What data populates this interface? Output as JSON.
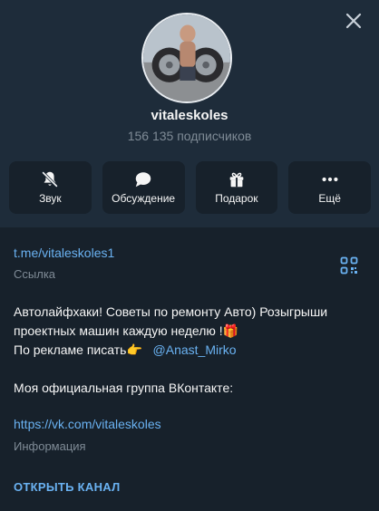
{
  "channel": {
    "name": "vitaleskoles",
    "subscribers": "156 135 подписчиков"
  },
  "actions": [
    {
      "label": "Звук",
      "icon": "bell-muted-icon"
    },
    {
      "label": "Обсуждение",
      "icon": "chat-bubble-icon"
    },
    {
      "label": "Подарок",
      "icon": "gift-icon"
    },
    {
      "label": "Ещё",
      "icon": "more-dots-icon"
    }
  ],
  "link": {
    "url": "t.me/vitaleskoles1",
    "caption": "Ссылка"
  },
  "description": {
    "line1": "Автолайфхаки! Советы по ремонту Авто) Розыгрыши",
    "line2": "проектных машин каждую неделю !",
    "line2_emoji": "🎁",
    "line3_prefix": "По рекламе писать",
    "line3_emoji": "👉",
    "mention": "@Anast_Mirko",
    "line4": "Моя официальная группа ВКонтакте:"
  },
  "info": {
    "vk_url": "https://vk.com/vitaleskoles",
    "caption": "Информация"
  },
  "open_channel_label": "ОТКРЫТЬ КАНАЛ",
  "colors": {
    "background": "#17212b",
    "header": "#1e2c3a",
    "accent": "#6ab2f2",
    "muted": "#7f8b96"
  }
}
